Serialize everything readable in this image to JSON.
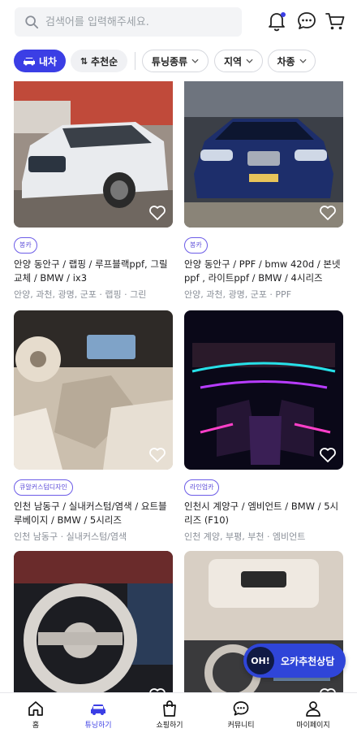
{
  "search": {
    "placeholder": "검색어를 입력해주세요."
  },
  "header_icons": [
    "bell-icon",
    "chat-icon",
    "cart-icon"
  ],
  "colors": {
    "accent": "#3b3ee5",
    "tag": "#6c5ce7"
  },
  "filters": {
    "active_label": "내차",
    "sort_label": "추천순",
    "dropdowns": [
      "튜닝종류",
      "지역",
      "차종"
    ]
  },
  "cards": [
    {
      "tag": "봉카",
      "title": "안양 동안구 / 랩핑 / 루프블랙ppf, 그릴교체 / BMW / ix3",
      "sub": "안양, 과천, 광명, 군포 · 랩핑 · 그린"
    },
    {
      "tag": "봉카",
      "title": "안양 동안구 / PPF / bmw 420d / 본넷ppf , 라이트ppf / BMW / 4시리즈",
      "sub": "안양, 과천, 광명, 군포 · PPF"
    },
    {
      "tag": "큐알커스텀디자인",
      "title": "인천 남동구 / 실내커스텀/염색 / 요트블루베이지 / BMW / 5시리즈",
      "sub": "인천 남동구 · 실내커스텀/염색"
    },
    {
      "tag": "라인업카",
      "title": "인천시 계양구 / 엠비언트 / BMW / 5시리즈 (F10)",
      "sub": "인천 계양, 부평, 부천 · 엠비언트"
    },
    {
      "tag": "",
      "title": "",
      "sub": ""
    },
    {
      "tag": "",
      "title": "",
      "sub": ""
    }
  ],
  "floating": {
    "badge": "OH!",
    "label": "오카추천상담"
  },
  "nav": [
    {
      "label": "홈",
      "icon": "home-icon"
    },
    {
      "label": "튜닝하기",
      "icon": "car-icon",
      "active": true
    },
    {
      "label": "쇼핑하기",
      "icon": "shopping-bag-icon"
    },
    {
      "label": "커뮤니티",
      "icon": "chat-icon"
    },
    {
      "label": "마이페이지",
      "icon": "person-icon"
    }
  ]
}
